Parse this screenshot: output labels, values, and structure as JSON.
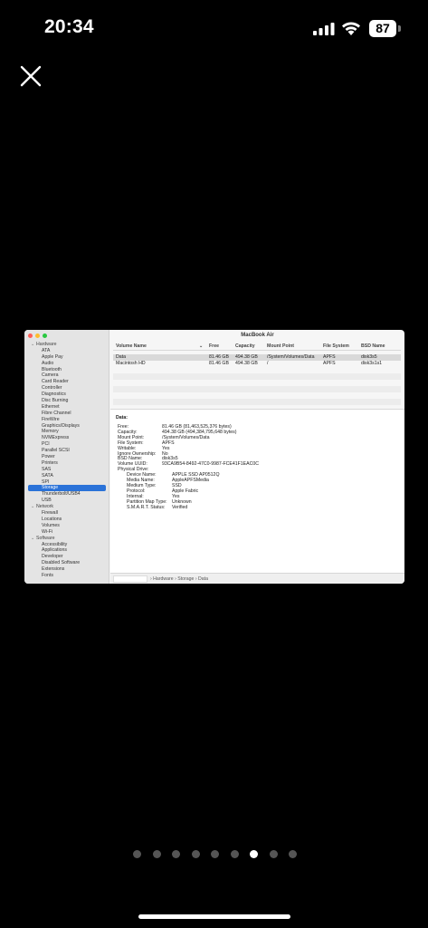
{
  "status_bar": {
    "time": "20:34",
    "battery": "87"
  },
  "window": {
    "title": "MacBook Air",
    "sidebar": [
      {
        "type": "group",
        "label": "Hardware"
      },
      {
        "type": "item",
        "label": "ATA"
      },
      {
        "type": "item",
        "label": "Apple Pay"
      },
      {
        "type": "item",
        "label": "Audio"
      },
      {
        "type": "item",
        "label": "Bluetooth"
      },
      {
        "type": "item",
        "label": "Camera"
      },
      {
        "type": "item",
        "label": "Card Reader"
      },
      {
        "type": "item",
        "label": "Controller"
      },
      {
        "type": "item",
        "label": "Diagnostics"
      },
      {
        "type": "item",
        "label": "Disc Burning"
      },
      {
        "type": "item",
        "label": "Ethernet"
      },
      {
        "type": "item",
        "label": "Fibre Channel"
      },
      {
        "type": "item",
        "label": "FireWire"
      },
      {
        "type": "item",
        "label": "Graphics/Displays"
      },
      {
        "type": "item",
        "label": "Memory"
      },
      {
        "type": "item",
        "label": "NVMExpress"
      },
      {
        "type": "item",
        "label": "PCI"
      },
      {
        "type": "item",
        "label": "Parallel SCSI"
      },
      {
        "type": "item",
        "label": "Power"
      },
      {
        "type": "item",
        "label": "Printers"
      },
      {
        "type": "item",
        "label": "SAS"
      },
      {
        "type": "item",
        "label": "SATA"
      },
      {
        "type": "item",
        "label": "SPI"
      },
      {
        "type": "item",
        "label": "Storage",
        "selected": true
      },
      {
        "type": "item",
        "label": "Thunderbolt/USB4"
      },
      {
        "type": "item",
        "label": "USB"
      },
      {
        "type": "group",
        "label": "Network"
      },
      {
        "type": "item",
        "label": "Firewall"
      },
      {
        "type": "item",
        "label": "Locations"
      },
      {
        "type": "item",
        "label": "Volumes"
      },
      {
        "type": "item",
        "label": "Wi-Fi"
      },
      {
        "type": "group",
        "label": "Software"
      },
      {
        "type": "item",
        "label": "Accessibility"
      },
      {
        "type": "item",
        "label": "Applications"
      },
      {
        "type": "item",
        "label": "Developer"
      },
      {
        "type": "item",
        "label": "Disabled Software"
      },
      {
        "type": "item",
        "label": "Extensions"
      },
      {
        "type": "item",
        "label": "Fonts"
      }
    ],
    "table": {
      "columns": [
        "Volume Name",
        "Free",
        "Capacity",
        "Mount Point",
        "File System",
        "BSD Name"
      ],
      "rows": [
        [
          "Data",
          "81.46 GB",
          "494.38 GB",
          "/System/Volumes/Data",
          "APFS",
          "disk3s5"
        ],
        [
          "Macintosh HD",
          "81.46 GB",
          "494.38 GB",
          "/",
          "APFS",
          "disk3s1s1"
        ]
      ]
    },
    "detail": {
      "title": "Data:",
      "fields": [
        {
          "k": "Free:",
          "v": "81.46 GB (81,463,525,376 bytes)"
        },
        {
          "k": "Capacity:",
          "v": "494.38 GB (494,384,795,648 bytes)"
        },
        {
          "k": "Mount Point:",
          "v": "/System/Volumes/Data"
        },
        {
          "k": "File System:",
          "v": "APFS"
        },
        {
          "k": "Writable:",
          "v": "Yes"
        },
        {
          "k": "Ignore Ownership:",
          "v": "No"
        },
        {
          "k": "BSD Name:",
          "v": "disk3s5"
        },
        {
          "k": "Volume UUID:",
          "v": "93CA9B54-8492-47C0-9987-FCE41F1EAC0C"
        },
        {
          "k": "Physical Drive:",
          "v": ""
        }
      ],
      "drive_fields": [
        {
          "k": "Device Name:",
          "v": "APPLE SSD AP0512Q"
        },
        {
          "k": "Media Name:",
          "v": "AppleAPFSMedia"
        },
        {
          "k": "Medium Type:",
          "v": "SSD"
        },
        {
          "k": "Protocol:",
          "v": "Apple Fabric"
        },
        {
          "k": "Internal:",
          "v": "Yes"
        },
        {
          "k": "Partition Map Type:",
          "v": "Unknown"
        },
        {
          "k": "S.M.A.R.T. Status:",
          "v": "Verified"
        }
      ]
    },
    "path_bar": "› Hardware › Storage › Data"
  },
  "pager": {
    "count": 9,
    "active_index": 6
  }
}
